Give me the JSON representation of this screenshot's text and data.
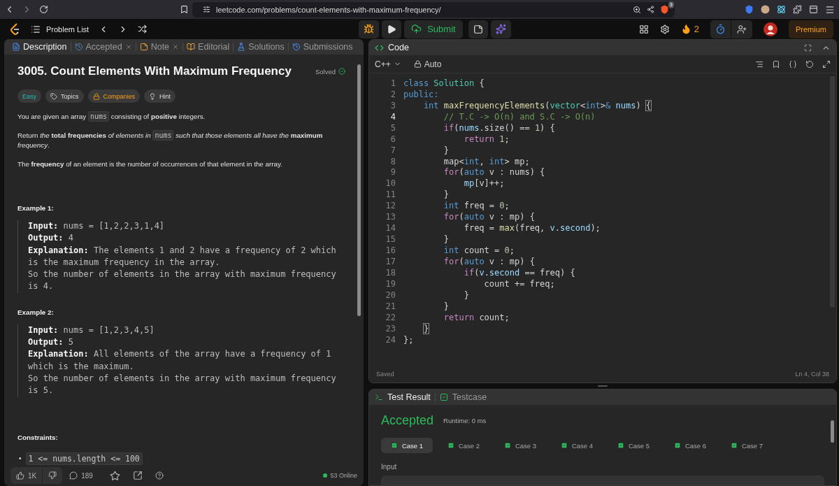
{
  "browser": {
    "url": "leetcode.com/problems/count-elements-with-maximum-frequency/",
    "shield_count": "3"
  },
  "nav": {
    "problem_list": "Problem List",
    "submit": "Submit",
    "streak": "2",
    "premium": "Premium"
  },
  "description": {
    "tabs": [
      {
        "label": "Description",
        "kind": "description",
        "selected": true,
        "closable": false
      },
      {
        "label": "Accepted",
        "kind": "accepted",
        "selected": false,
        "closable": true
      },
      {
        "label": "Note",
        "kind": "note",
        "selected": false,
        "closable": true
      },
      {
        "label": "Editorial",
        "kind": "editorial",
        "selected": false,
        "closable": false
      },
      {
        "label": "Solutions",
        "kind": "solutions",
        "selected": false,
        "closable": false
      },
      {
        "label": "Submissions",
        "kind": "submissions",
        "selected": false,
        "closable": false
      }
    ],
    "title": "3005. Count Elements With Maximum Frequency",
    "status": "Solved",
    "tags": [
      {
        "label": "Easy",
        "kind": "difficulty"
      },
      {
        "label": "Topics",
        "kind": "topics"
      },
      {
        "label": "Companies",
        "kind": "companies"
      },
      {
        "label": "Hint",
        "kind": "hint"
      }
    ],
    "paragraphs": [
      [
        {
          "text": "You are given an array ",
          "kind": "text"
        },
        {
          "text": "nums",
          "kind": "code"
        },
        {
          "text": " consisting of **positive** integers.",
          "kind": "text"
        }
      ],
      [
        {
          "text": "Return *the* **total frequencies** *of elements in* ",
          "kind": "text"
        },
        {
          "text": "nums",
          "kind": "code"
        },
        {
          "text": " *such that those elements all have the* **maximum** *frequency*.",
          "kind": "text"
        }
      ],
      [
        {
          "text": "The **frequency** of an element is the number of occurrences of that element in the array.",
          "kind": "text"
        }
      ]
    ],
    "examples": [
      {
        "heading": "Example 1:",
        "lines": [
          {
            "label": "Input:",
            "value": "nums = [1,2,2,3,1,4]"
          },
          {
            "label": "Output:",
            "value": "4"
          },
          {
            "label": "Explanation:",
            "value": "The elements 1 and 2 have a frequency of 2 which is the maximum frequency in the array.\nSo the number of elements in the array with maximum frequency is 4."
          }
        ]
      },
      {
        "heading": "Example 2:",
        "lines": [
          {
            "label": "Input:",
            "value": "nums = [1,2,3,4,5]"
          },
          {
            "label": "Output:",
            "value": "5"
          },
          {
            "label": "Explanation:",
            "value": "All elements of the array have a frequency of 1 which is the maximum.\nSo the number of elements in the array with maximum frequency is 5."
          }
        ]
      }
    ],
    "constraints": {
      "heading": "Constraints:",
      "items": [
        {
          "bullet": "•",
          "text": "1 <= nums.length <= 100"
        }
      ]
    },
    "footer": {
      "likes": "1K",
      "comments": "189",
      "online": "53 Online"
    }
  },
  "editor": {
    "title": "Code",
    "language": "C++",
    "mode": "Auto",
    "status": "Saved",
    "position": "Ln 4, Col 38",
    "lines": [
      {
        "number": "1",
        "active": false,
        "tokens": [
          {
            "text": "class ",
            "kind": "kw"
          },
          {
            "text": "Solution",
            "kind": "type"
          },
          {
            "text": " {",
            "kind": "plain"
          }
        ]
      },
      {
        "number": "2",
        "active": false,
        "tokens": [
          {
            "text": "public:",
            "kind": "kw"
          }
        ]
      },
      {
        "number": "3",
        "active": false,
        "tokens": [
          {
            "text": "    int ",
            "kind": "kw"
          },
          {
            "text": "maxFrequencyElements",
            "kind": "fn"
          },
          {
            "text": "(",
            "kind": "plain"
          },
          {
            "text": "vector",
            "kind": "type"
          },
          {
            "text": "<",
            "kind": "plain"
          },
          {
            "text": "int",
            "kind": "kw"
          },
          {
            "text": ">",
            "kind": "plain"
          },
          {
            "text": "&",
            "kind": "kw"
          },
          {
            "text": " nums",
            "kind": "var"
          },
          {
            "text": ") ",
            "kind": "plain"
          },
          {
            "text": "{",
            "kind": "match"
          }
        ]
      },
      {
        "number": "4",
        "active": true,
        "tokens": [
          {
            "text": "        // T.C -> O(n) and S.C -> O(n)",
            "kind": "comment"
          }
        ]
      },
      {
        "number": "5",
        "active": false,
        "tokens": [
          {
            "text": "        if",
            "kind": "ctrl"
          },
          {
            "text": "(",
            "kind": "plain"
          },
          {
            "text": "nums",
            "kind": "var"
          },
          {
            "text": ".size() == ",
            "kind": "plain"
          },
          {
            "text": "1",
            "kind": "num"
          },
          {
            "text": ") {",
            "kind": "plain"
          }
        ]
      },
      {
        "number": "6",
        "active": false,
        "tokens": [
          {
            "text": "            return ",
            "kind": "ctrl"
          },
          {
            "text": "1",
            "kind": "num"
          },
          {
            "text": ";",
            "kind": "plain"
          }
        ]
      },
      {
        "number": "7",
        "active": false,
        "tokens": [
          {
            "text": "        }",
            "kind": "plain"
          }
        ]
      },
      {
        "number": "8",
        "active": false,
        "tokens": [
          {
            "text": "        map<",
            "kind": "plain"
          },
          {
            "text": "int",
            "kind": "kw"
          },
          {
            "text": ", ",
            "kind": "plain"
          },
          {
            "text": "int",
            "kind": "kw"
          },
          {
            "text": "> mp;",
            "kind": "plain"
          }
        ]
      },
      {
        "number": "9",
        "active": false,
        "tokens": [
          {
            "text": "        for",
            "kind": "ctrl"
          },
          {
            "text": "(",
            "kind": "plain"
          },
          {
            "text": "auto",
            "kind": "kw"
          },
          {
            "text": " v : nums) {",
            "kind": "plain"
          }
        ]
      },
      {
        "number": "10",
        "active": false,
        "tokens": [
          {
            "text": "            mp",
            "kind": "var"
          },
          {
            "text": "[v]++;",
            "kind": "plain"
          }
        ]
      },
      {
        "number": "11",
        "active": false,
        "tokens": [
          {
            "text": "        }",
            "kind": "plain"
          }
        ]
      },
      {
        "number": "12",
        "active": false,
        "tokens": [
          {
            "text": "        int",
            "kind": "kw"
          },
          {
            "text": " freq = ",
            "kind": "plain"
          },
          {
            "text": "0",
            "kind": "num"
          },
          {
            "text": ";",
            "kind": "plain"
          }
        ]
      },
      {
        "number": "13",
        "active": false,
        "tokens": [
          {
            "text": "        for",
            "kind": "ctrl"
          },
          {
            "text": "(",
            "kind": "plain"
          },
          {
            "text": "auto",
            "kind": "kw"
          },
          {
            "text": " v : mp) {",
            "kind": "plain"
          }
        ]
      },
      {
        "number": "14",
        "active": false,
        "tokens": [
          {
            "text": "            freq = ",
            "kind": "plain"
          },
          {
            "text": "max",
            "kind": "fn"
          },
          {
            "text": "(freq, ",
            "kind": "plain"
          },
          {
            "text": "v",
            "kind": "var"
          },
          {
            "text": ".",
            "kind": "plain"
          },
          {
            "text": "second",
            "kind": "var"
          },
          {
            "text": ");",
            "kind": "plain"
          }
        ]
      },
      {
        "number": "15",
        "active": false,
        "tokens": [
          {
            "text": "        }",
            "kind": "plain"
          }
        ]
      },
      {
        "number": "16",
        "active": false,
        "tokens": [
          {
            "text": "        int",
            "kind": "kw"
          },
          {
            "text": " count = ",
            "kind": "plain"
          },
          {
            "text": "0",
            "kind": "num"
          },
          {
            "text": ";",
            "kind": "plain"
          }
        ]
      },
      {
        "number": "17",
        "active": false,
        "tokens": [
          {
            "text": "        for",
            "kind": "ctrl"
          },
          {
            "text": "(",
            "kind": "plain"
          },
          {
            "text": "auto",
            "kind": "kw"
          },
          {
            "text": " v : mp) {",
            "kind": "plain"
          }
        ]
      },
      {
        "number": "18",
        "active": false,
        "tokens": [
          {
            "text": "            if",
            "kind": "ctrl"
          },
          {
            "text": "(",
            "kind": "plain"
          },
          {
            "text": "v",
            "kind": "var"
          },
          {
            "text": ".",
            "kind": "plain"
          },
          {
            "text": "second",
            "kind": "var"
          },
          {
            "text": " == freq) {",
            "kind": "plain"
          }
        ]
      },
      {
        "number": "19",
        "active": false,
        "tokens": [
          {
            "text": "                count += freq;",
            "kind": "plain"
          }
        ]
      },
      {
        "number": "20",
        "active": false,
        "tokens": [
          {
            "text": "            }",
            "kind": "plain"
          }
        ]
      },
      {
        "number": "21",
        "active": false,
        "tokens": [
          {
            "text": "        }",
            "kind": "plain"
          }
        ]
      },
      {
        "number": "22",
        "active": false,
        "tokens": [
          {
            "text": "        return",
            "kind": "ctrl"
          },
          {
            "text": " count;",
            "kind": "plain"
          }
        ]
      },
      {
        "number": "23",
        "active": false,
        "tokens": [
          {
            "text": "    }",
            "kind": "match"
          }
        ]
      },
      {
        "number": "24",
        "active": false,
        "tokens": [
          {
            "text": "};",
            "kind": "plain"
          }
        ]
      }
    ]
  },
  "test": {
    "tabs": [
      {
        "label": "Test Result",
        "kind": "result",
        "selected": true
      },
      {
        "label": "Testcase",
        "kind": "testcase",
        "selected": false
      }
    ],
    "verdict": "Accepted",
    "runtime": "Runtime: 0 ms",
    "cases": [
      {
        "label": "Case 1",
        "selected": true,
        "passed": true
      },
      {
        "label": "Case 2",
        "selected": false,
        "passed": true
      },
      {
        "label": "Case 3",
        "selected": false,
        "passed": true
      },
      {
        "label": "Case 4",
        "selected": false,
        "passed": true
      },
      {
        "label": "Case 5",
        "selected": false,
        "passed": true
      },
      {
        "label": "Case 6",
        "selected": false,
        "passed": true
      },
      {
        "label": "Case 7",
        "selected": false,
        "passed": true
      }
    ],
    "input_label": "Input"
  }
}
